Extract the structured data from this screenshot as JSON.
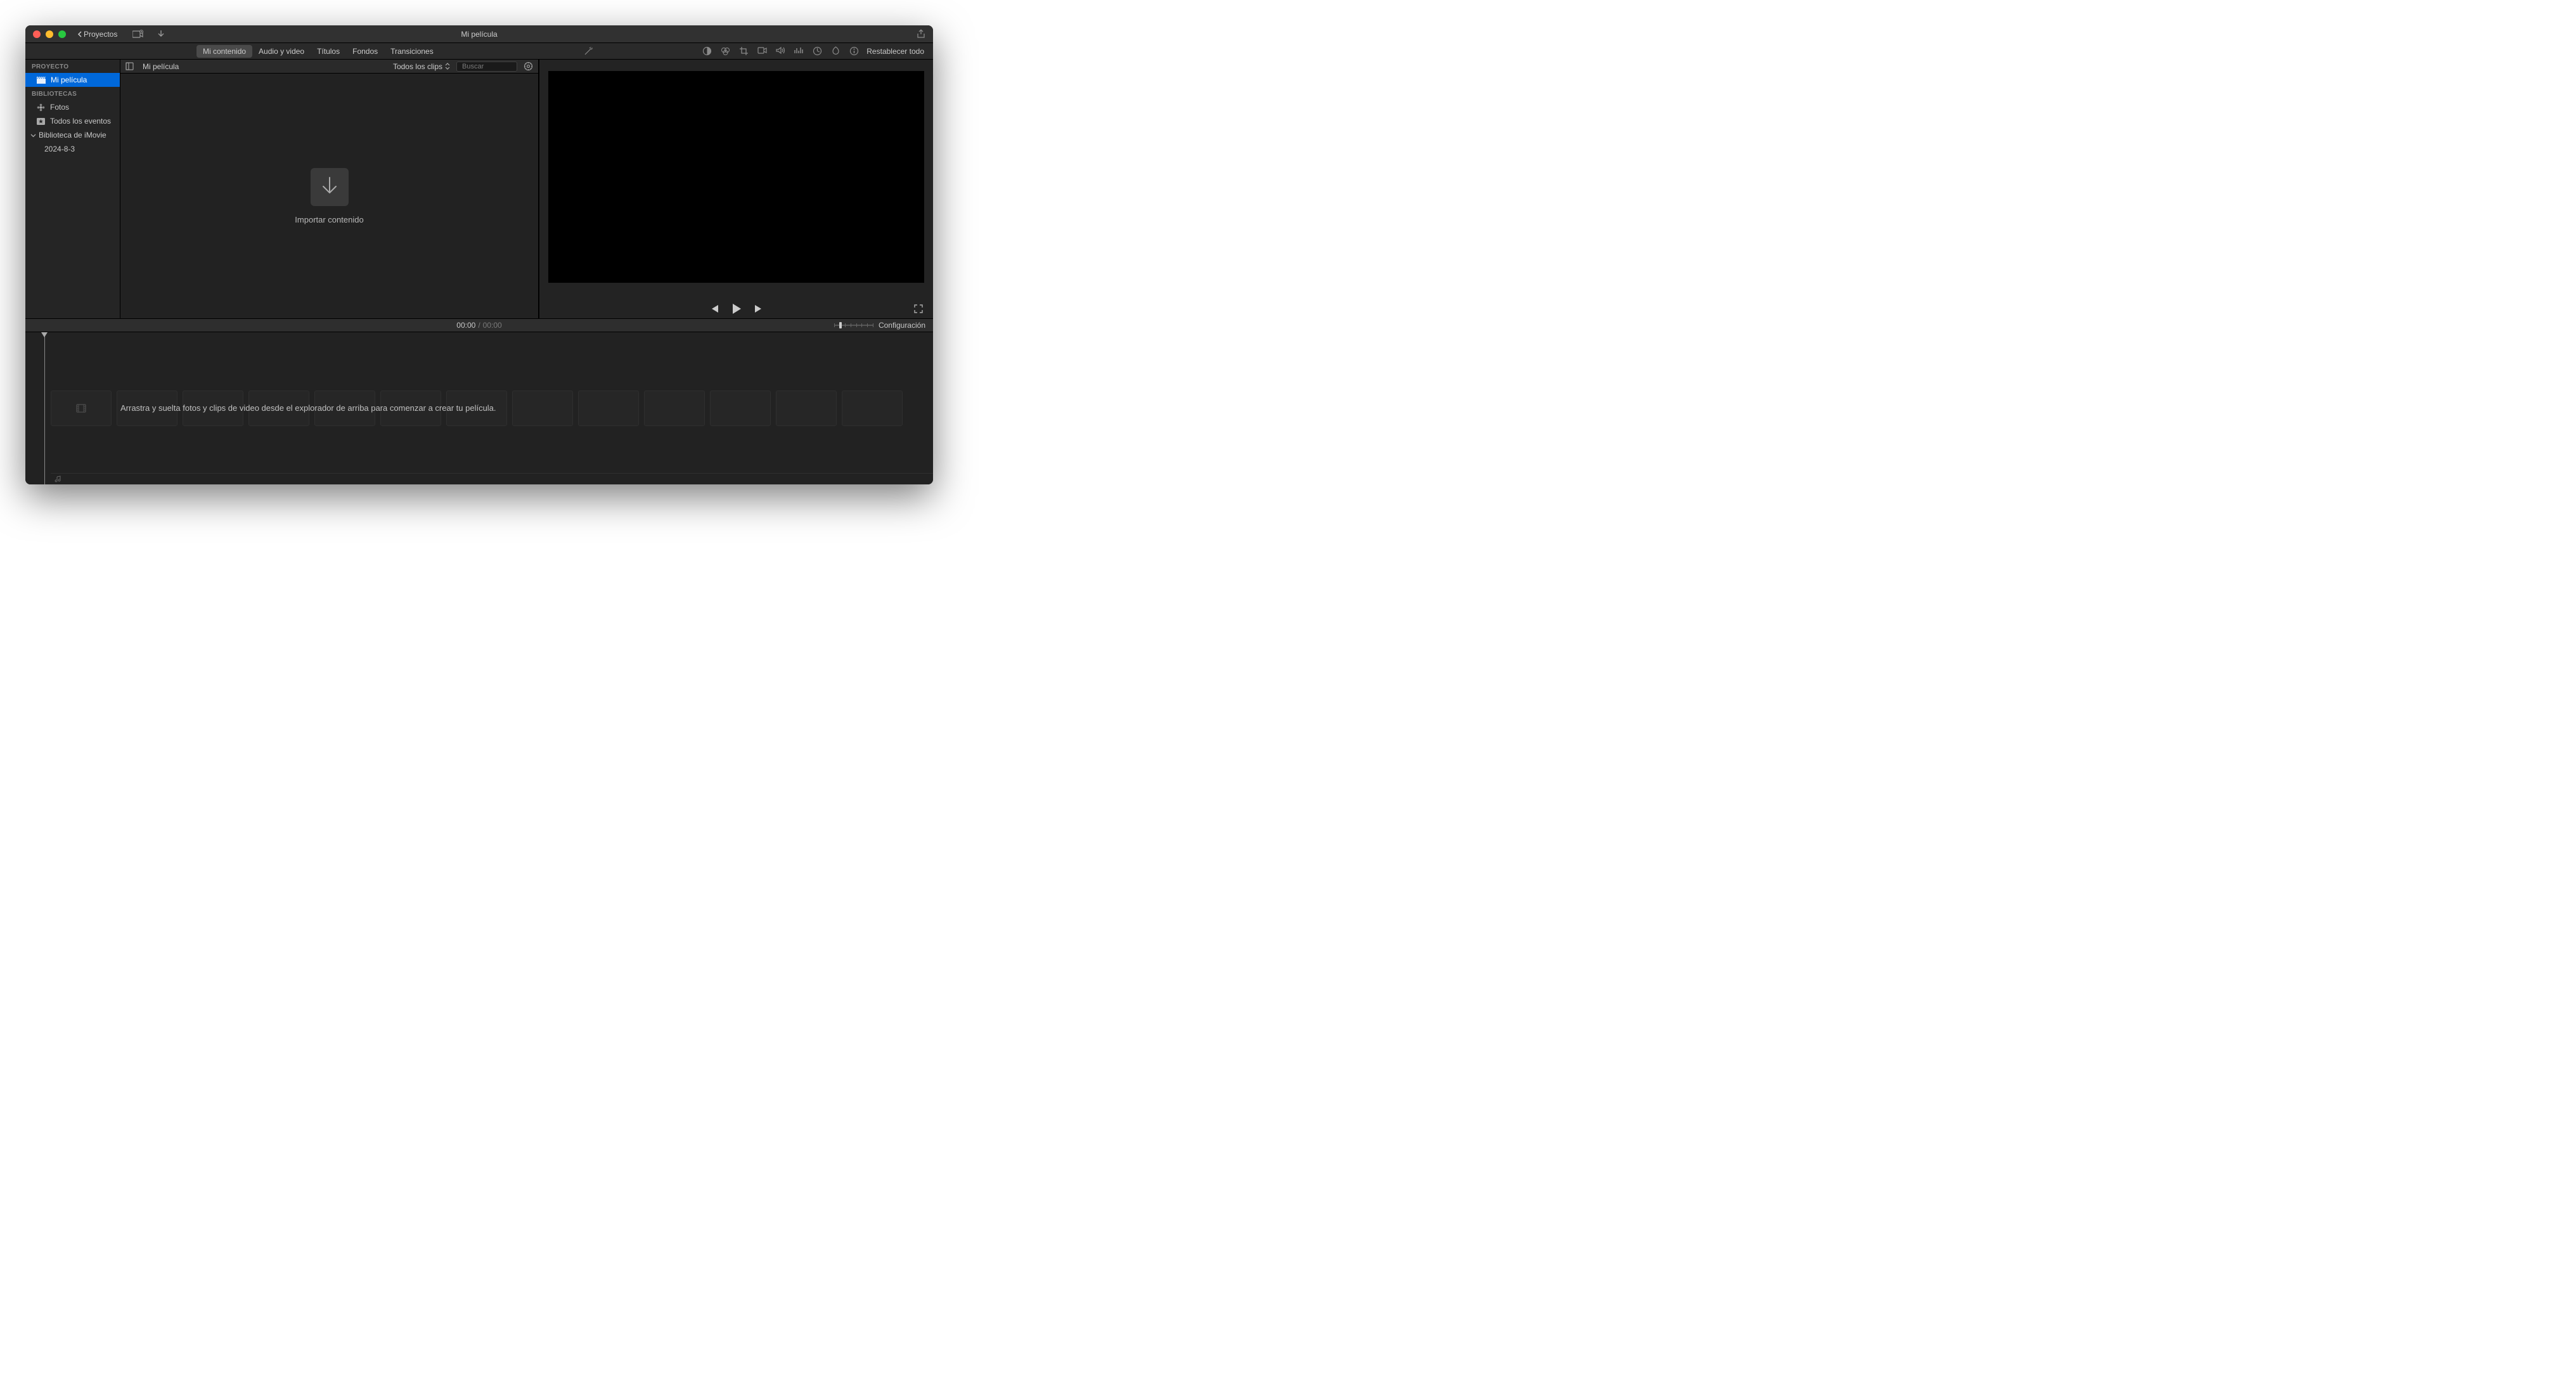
{
  "titlebar": {
    "back_label": "Proyectos",
    "title": "Mi película"
  },
  "tabs": {
    "mi_contenido": "Mi contenido",
    "audio_video": "Audio y video",
    "titulos": "Títulos",
    "fondos": "Fondos",
    "transiciones": "Transiciones"
  },
  "viewer_toolbar": {
    "reset": "Restablecer todo"
  },
  "sidebar": {
    "proyecto_h": "PROYECTO",
    "proyecto_name": "Mi película",
    "bibliotecas_h": "BIBLIOTECAS",
    "fotos": "Fotos",
    "eventos": "Todos los eventos",
    "lib": "Biblioteca de iMovie",
    "date": "2024-8-3"
  },
  "browser": {
    "title": "Mi película",
    "filter": "Todos los clips",
    "search_placeholder": "Buscar",
    "import_label": "Importar contenido"
  },
  "timeline_bar": {
    "current": "00:00",
    "duration": "00:00",
    "config": "Configuración"
  },
  "timeline": {
    "hint": "Arrastra y suelta fotos y clips de video desde el explorador de arriba para comenzar a crear tu película."
  }
}
